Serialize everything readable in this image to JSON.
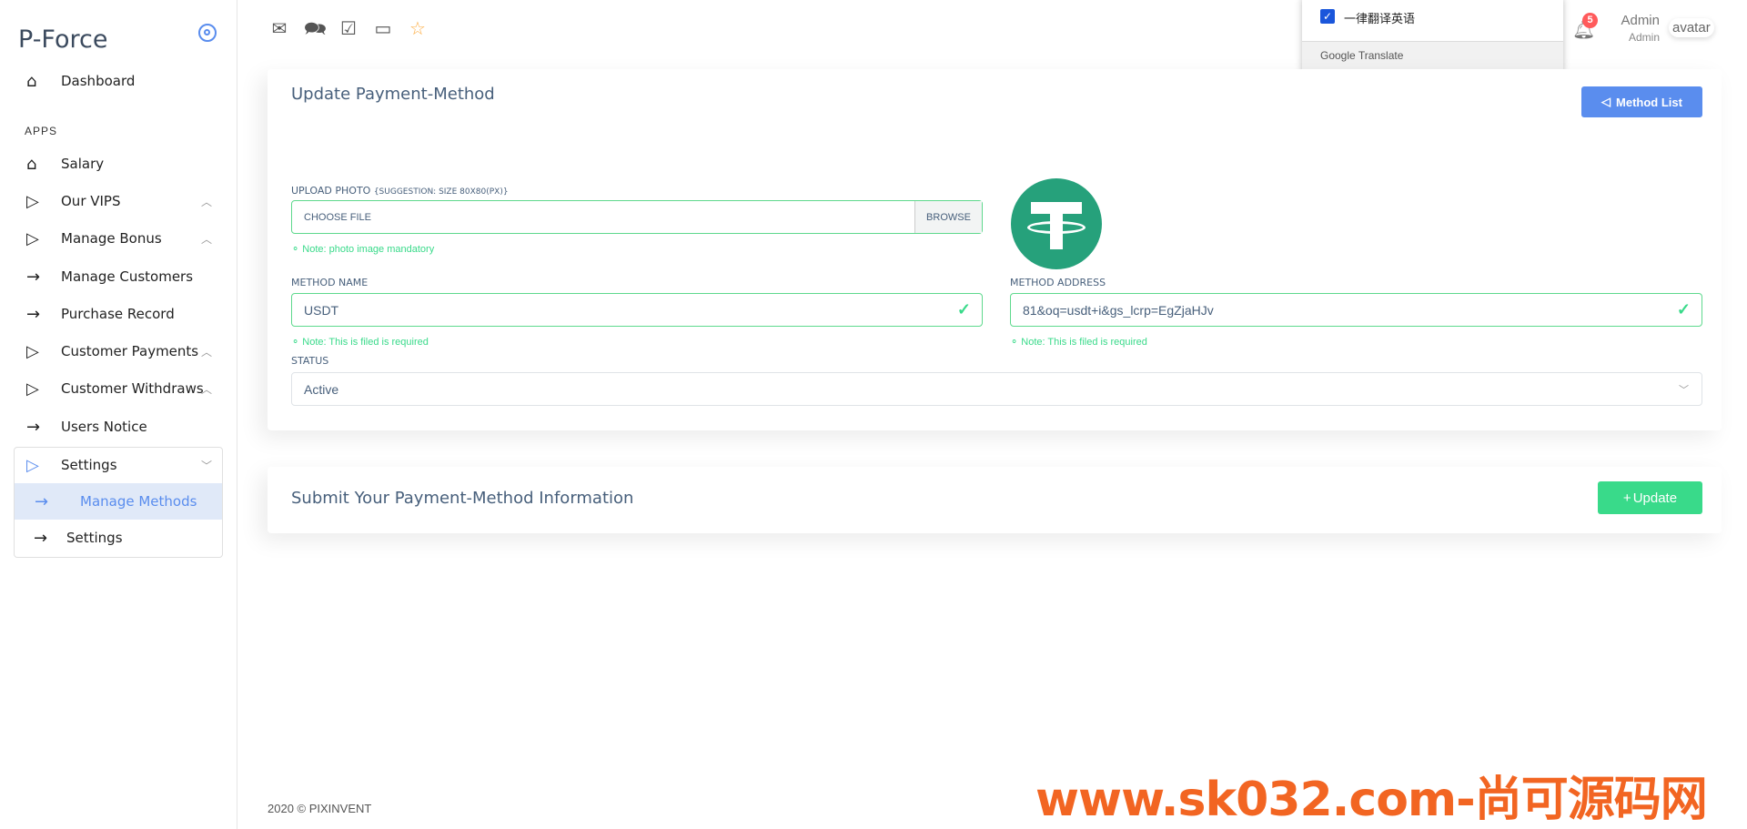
{
  "brand": "P-Force",
  "sidebar": {
    "section": "APPS",
    "items": [
      {
        "label": "Dashboard",
        "icon": "home-icon"
      },
      {
        "label": "Salary",
        "icon": "home-icon"
      },
      {
        "label": "Our VIPS",
        "icon": "play-icon"
      },
      {
        "label": "Manage Bonus",
        "icon": "play-icon"
      },
      {
        "label": "Manage Customers",
        "icon": "arrow-right-icon"
      },
      {
        "label": "Purchase Record",
        "icon": "arrow-right-icon"
      },
      {
        "label": "Customer Payments",
        "icon": "play-icon"
      },
      {
        "label": "Customer Withdraws",
        "icon": "play-icon"
      },
      {
        "label": "Users Notice",
        "icon": "arrow-right-icon"
      },
      {
        "label": "Settings",
        "icon": "play-icon"
      },
      {
        "label": "Manage Methods",
        "icon": "arrow-right-icon"
      },
      {
        "label": "Settings",
        "icon": "arrow-right-icon"
      }
    ]
  },
  "header": {
    "notifications": "5",
    "user_name": "Admin",
    "user_role": "Admin",
    "avatar_alt": "avatar"
  },
  "translate_popup": {
    "option": "一律翻译英语",
    "footer": "Google Translate"
  },
  "form": {
    "title": "Update Payment-Method",
    "method_list": "Method List",
    "upload_label": "Upload Photo",
    "upload_hint": "{Suggestion: Size 80x80(px)}",
    "file_placeholder": "CHOOSE FILE",
    "browse": "BROWSE",
    "upload_note": "Note: photo image mandatory",
    "method_name_label": "Method Name",
    "method_name": "USDT",
    "name_note": "Note: This is filed is required",
    "method_address_label": "Method Address",
    "method_address": "81&oq=usdt+i&gs_lcrp=EgZjaHJv",
    "address_note": "Note: This is filed is required",
    "status_label": "Status",
    "status": "Active"
  },
  "submit": {
    "title": "Submit Your Payment-Method Information",
    "update": "Update"
  },
  "footer": "2020 © PIXINVENT",
  "watermark": "www.sk032.com-尚可源码网",
  "colors": {
    "primary": "#5a8dee",
    "success": "#39da8a",
    "tether": "#26a17b"
  }
}
